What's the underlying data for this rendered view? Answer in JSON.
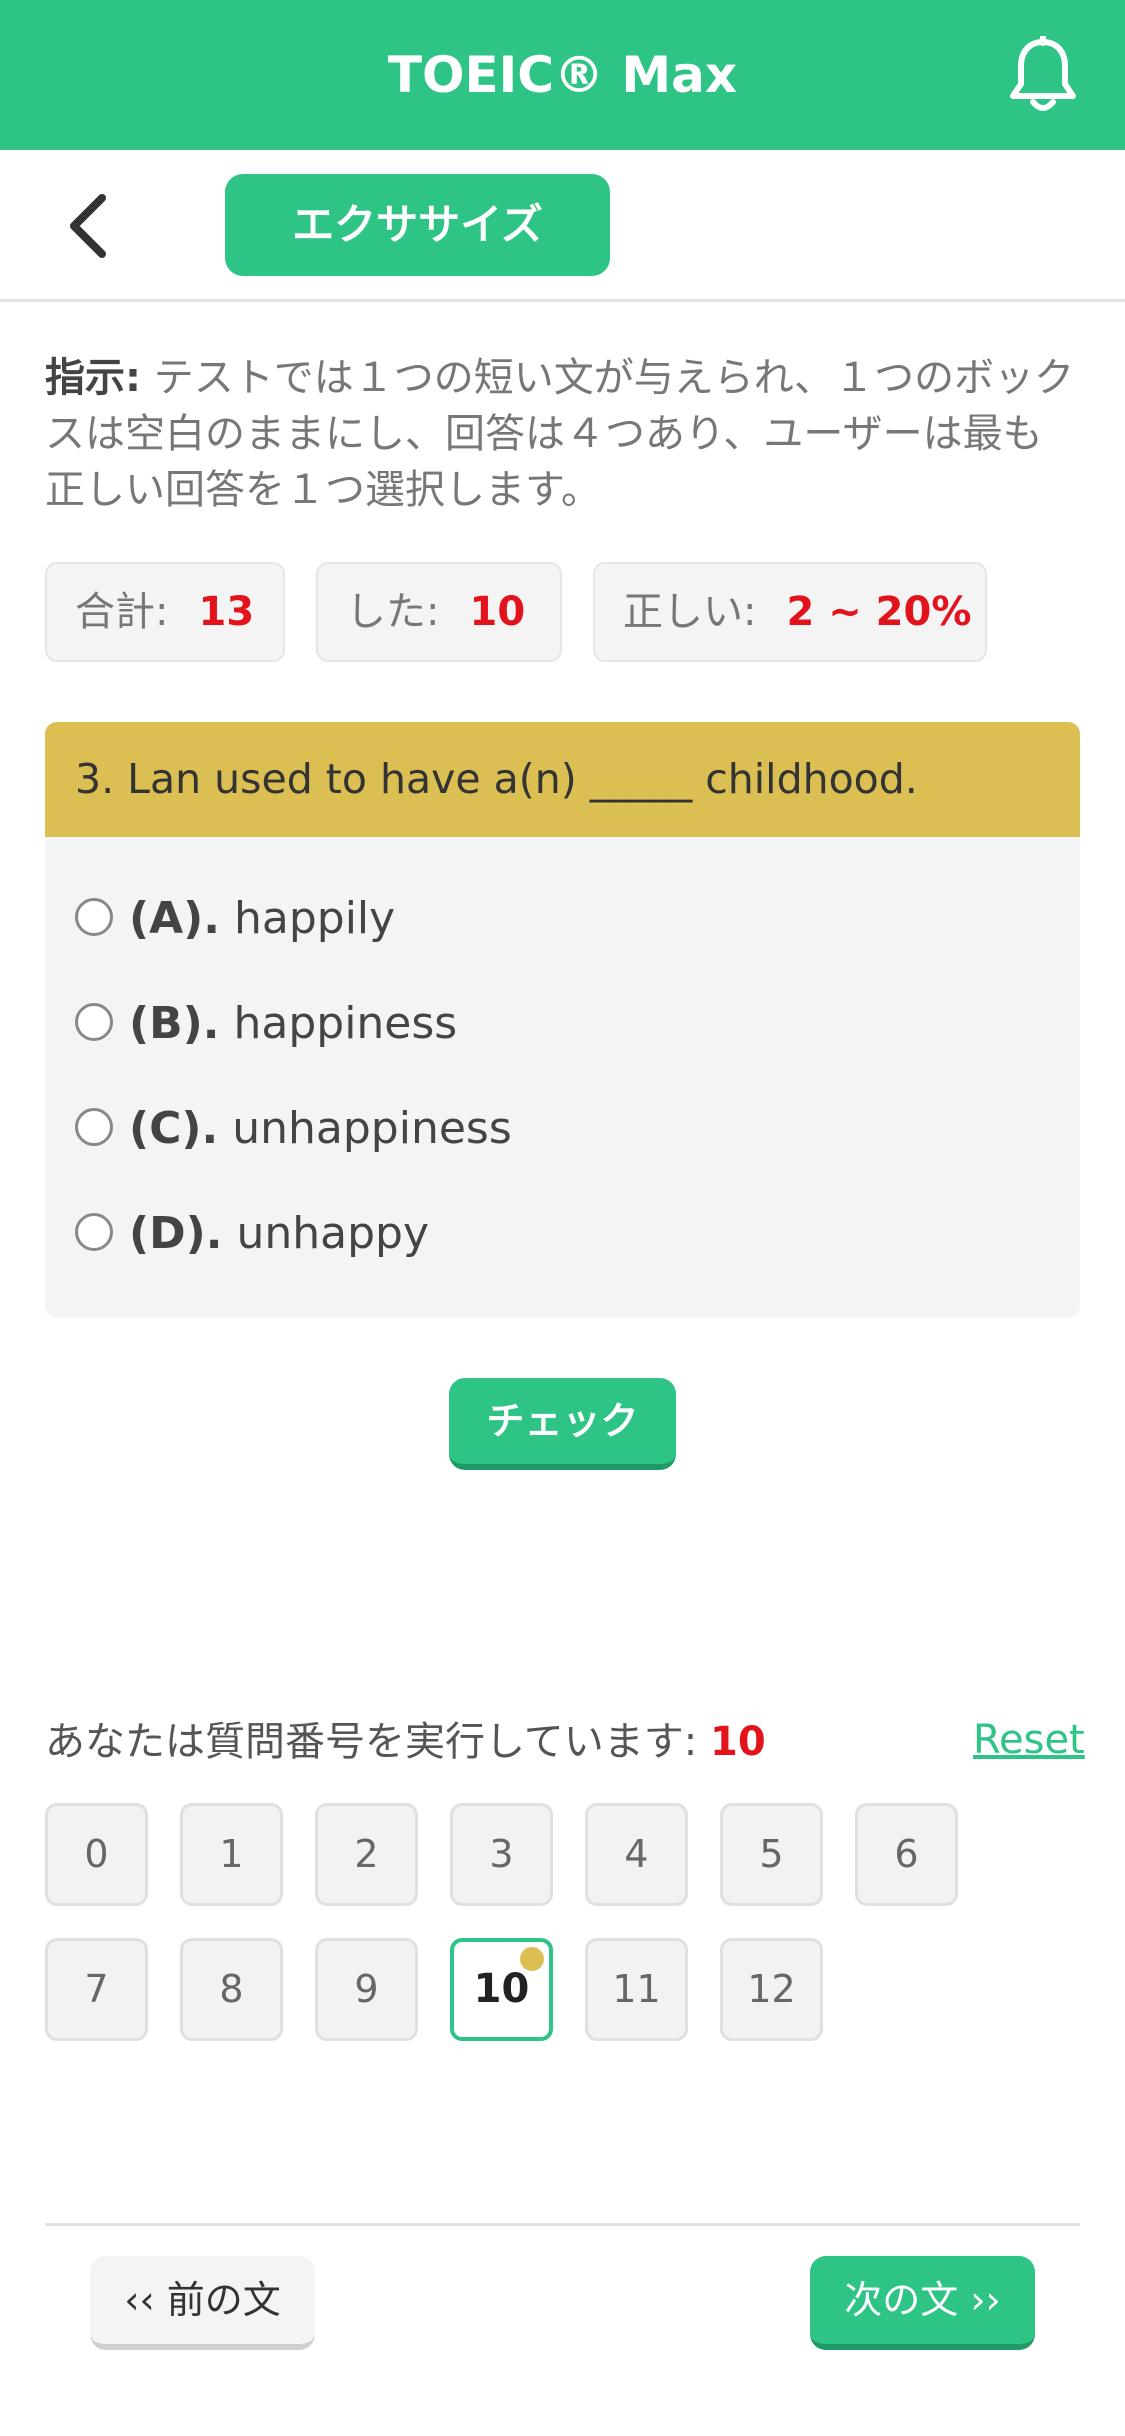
{
  "header": {
    "title": "TOEIC® Max",
    "bell_icon": "bell-icon"
  },
  "subbar": {
    "back_icon": "chevron-left-icon",
    "tab_label": "エクササイズ"
  },
  "instructions": {
    "label": "指示:",
    "text": " テストでは１つの短い文が与えられ、１つのボックスは空白のままにし、回答は４つあり、ユーザーは最も正しい回答を１つ選択します。"
  },
  "stats": {
    "total_label": "合計:",
    "total_value": "13",
    "done_label": "した:",
    "done_value": "10",
    "correct_label": "正しい:",
    "correct_value": "2 ~ 20%"
  },
  "question": {
    "text": "3. Lan used to have a(n) _____ childhood.",
    "options": [
      {
        "key": "(A).",
        "text": "happily"
      },
      {
        "key": "(B).",
        "text": "happiness"
      },
      {
        "key": "(C).",
        "text": "unhappiness"
      },
      {
        "key": "(D).",
        "text": "unhappy"
      }
    ]
  },
  "check_label": "チェック",
  "progress": {
    "label": "あなたは質問番号を実行しています:",
    "current": "10",
    "reset_label": "Reset",
    "numbers": [
      "0",
      "1",
      "2",
      "3",
      "4",
      "5",
      "6",
      "7",
      "8",
      "9",
      "10",
      "11",
      "12"
    ]
  },
  "nav": {
    "prev_label": "‹‹ 前の文",
    "next_label": "次の文 ››"
  },
  "colors": {
    "brand": "#2ec486",
    "accent_yellow": "#dbbf52",
    "highlight_red": "#e3131d"
  }
}
